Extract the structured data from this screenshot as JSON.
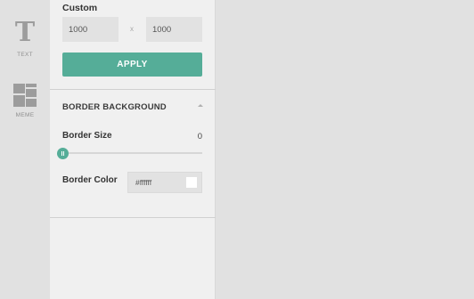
{
  "rail": {
    "items": [
      {
        "label": "TEXT",
        "icon": "text-icon"
      },
      {
        "label": "MEME",
        "icon": "meme-layout-icon"
      }
    ]
  },
  "panel": {
    "custom": {
      "label": "Custom",
      "width_value": "1000",
      "height_value": "1000",
      "separator": "x",
      "apply_label": "APPLY"
    },
    "border_section": {
      "title": "BORDER BACKGROUND",
      "collapse_icon": "caret-up-icon",
      "size_label": "Border Size",
      "size_value": "0",
      "size_fraction": 0,
      "color_label": "Border Color",
      "color_value": "#ffffff"
    }
  },
  "colors": {
    "accent": "#55ad98",
    "panel_bg": "#f0f0f0",
    "rail_bg": "#e1e1e1",
    "canvas_bg": "#e1e1e1"
  }
}
